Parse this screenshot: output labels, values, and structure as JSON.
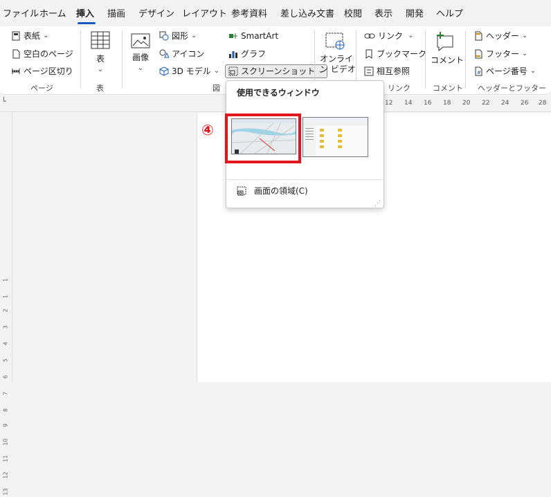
{
  "tabs": [
    "ファイル",
    "ホーム",
    "挿入",
    "描画",
    "デザイン",
    "レイアウト",
    "参考資料",
    "差し込み文書",
    "校閲",
    "表示",
    "開発",
    "ヘルプ"
  ],
  "active_tab": "挿入",
  "ribbon": {
    "pages": {
      "cover": "表紙",
      "blank": "空白のページ",
      "break": "ページ区切り",
      "group": "ページ"
    },
    "table": {
      "label": "表",
      "group": "表"
    },
    "illustrations": {
      "image": "画像",
      "shapes": "図形",
      "icons": "アイコン",
      "model3d": "3D モデル",
      "smartart": "SmartArt",
      "chart": "グラフ",
      "screenshot": "スクリーンショット",
      "group": "図"
    },
    "media": {
      "online_video_line1": "オンライ",
      "online_video_line2": "ン ビデオ"
    },
    "links": {
      "link": "リンク",
      "bookmark": "ブックマーク",
      "crossref": "相互参照",
      "group": "リンク"
    },
    "comments": {
      "comment": "コメント",
      "group": "コメント"
    },
    "header_footer": {
      "header": "ヘッダー",
      "footer": "フッター",
      "page_number": "ページ番号",
      "group": "ヘッダーとフッター"
    }
  },
  "ruler": {
    "top": [
      "12",
      "14",
      "16",
      "18",
      "20",
      "22",
      "24",
      "26",
      "28"
    ],
    "left": [
      "1",
      "1",
      "2",
      "3",
      "4",
      "5",
      "6",
      "7",
      "8",
      "9",
      "10",
      "11",
      "12",
      "13"
    ]
  },
  "dropdown": {
    "title": "使用できるウィンドウ",
    "screen_clipping": "画面の領域(C)"
  },
  "annotation": {
    "step": "④",
    "color": "#e0161c"
  },
  "colors": {
    "accent": "#185abd",
    "highlight": "#e0161c"
  }
}
